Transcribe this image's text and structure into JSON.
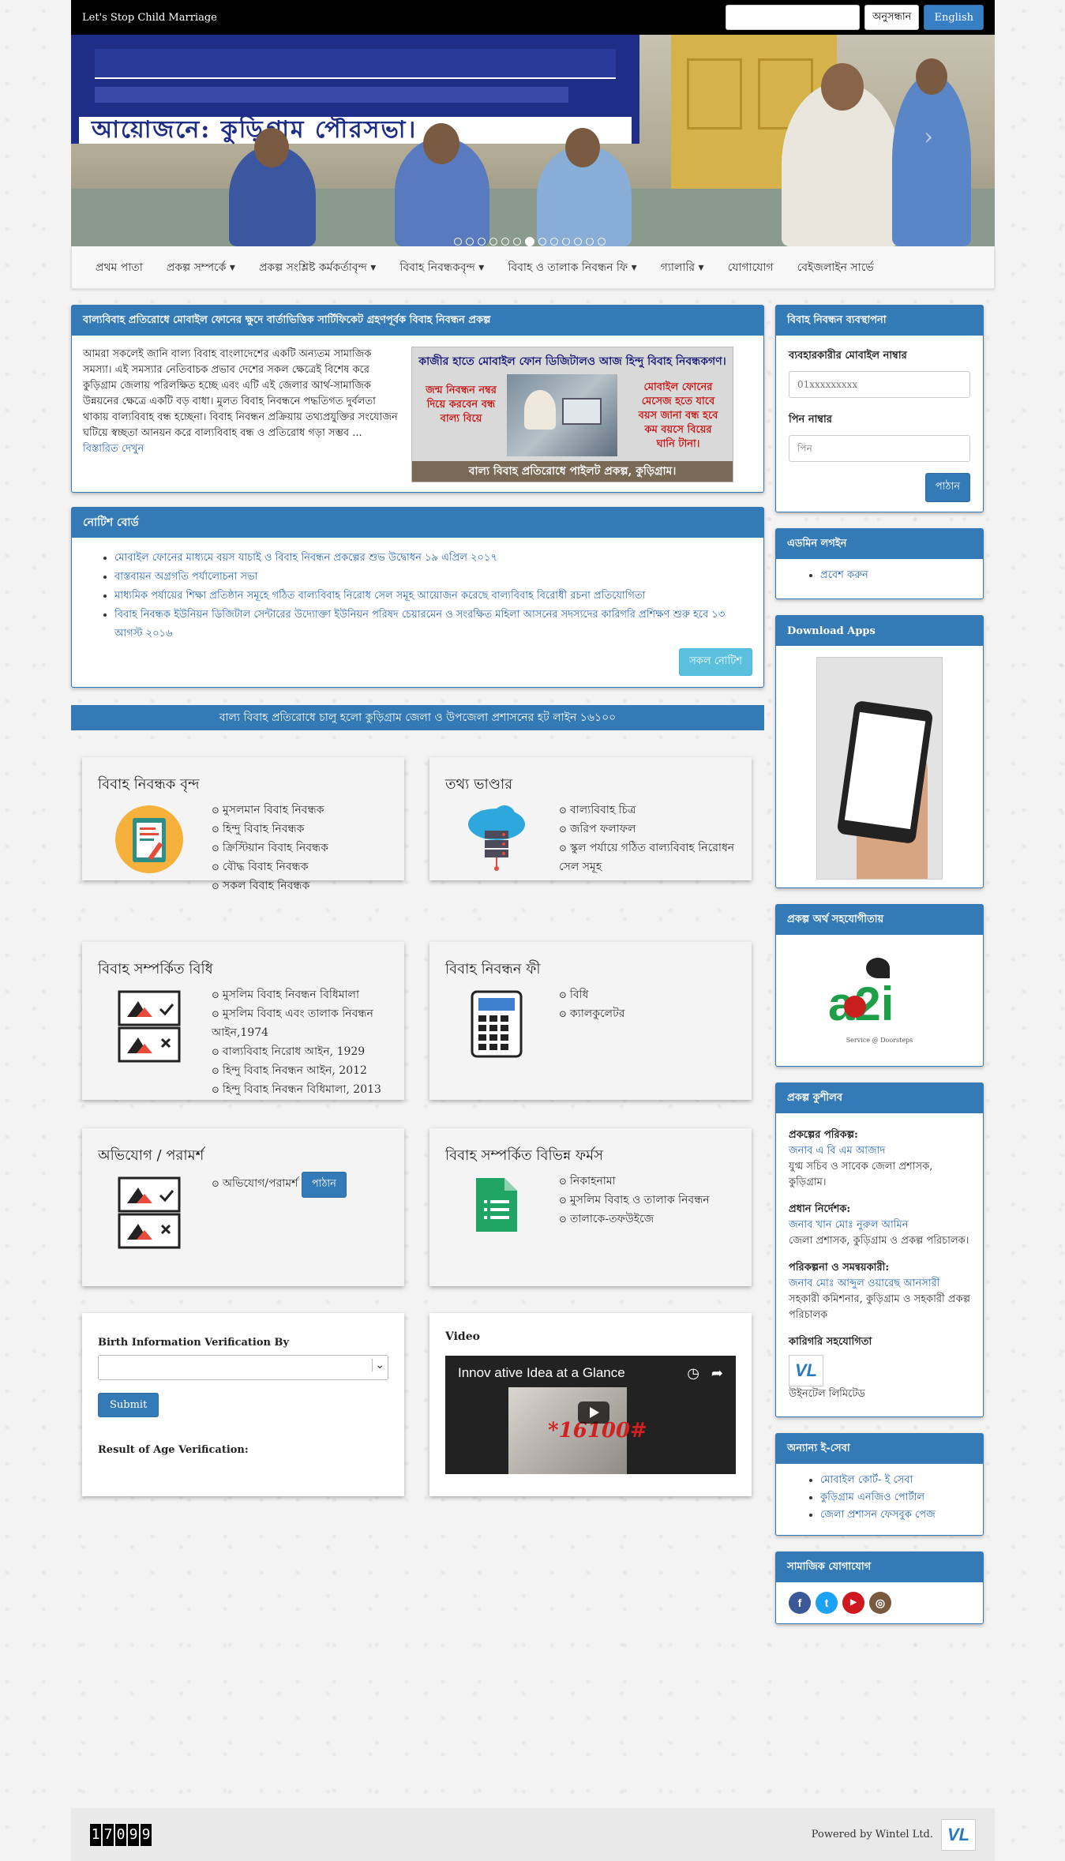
{
  "topbar": {
    "brand": "Let's Stop Child Marriage",
    "search_button": "অনুসন্ধান",
    "lang_button": "English"
  },
  "slider": {
    "banner_text": "আয়োজনে: কুড়িগ্রাম পৌরসভা।",
    "active_slide": 7,
    "total_slides": 13
  },
  "nav": {
    "items": [
      "প্রথম পাতা",
      "প্রকল্প সম্পর্কে ▾",
      "প্রকল্প সংশ্লিষ্ট কর্মকর্তাবৃন্দ ▾",
      "বিবাহ নিবন্ধকবৃন্দ ▾",
      "বিবাহ ও তালাক নিবন্ধন ফি ▾",
      "গ্যালারি ▾",
      "যোগাযোগ",
      "বেইজলাইন সার্ভে"
    ]
  },
  "intro": {
    "title": "বাল্যবিবাহ প্রতিরোধে মোবাইল ফোনের ক্ষুদে বার্তাভিত্তিক সার্টিফিকেট গ্রহণপূর্বক বিবাহ নিবন্ধন প্রকল্প",
    "text": "আমরা সকলেই জানি বাল্য বিবাহ বাংলাদেশের একটি অন্যতম সামাজিক সমস্যা। এই সমস্যার নেতিবাচক প্রভাব দেশের সকল ক্ষেত্রেই বিশেষ করে কুড়িগ্রাম জেলায় পরিলক্ষিত হচ্ছে এবং এটি এই জেলার আর্থ-সামাজিক উন্নয়নের ক্ষেত্রে একটি বড় বাধা। মুলত বিবাহ নিবন্ধনে পদ্ধতিগত দুর্বলতা থাকায় বাল্যবিবাহ বন্ধ হচ্ছেনা। বিবাহ নিবন্ধন প্রক্রিয়ায় তথ্যপ্রযুক্তির সংযোজন ঘটিয়ে স্বচ্ছতা আনয়ন করে বাল্যবিবাহ বন্ধ ও প্রতিরোধ গড়া সম্ভব ... ",
    "more": "বিস্তারিত দেখুন",
    "promo": {
      "title": "কাজীর হাতে মোবাইল ফোন ডিজিটালও আজ হিন্দু বিবাহ নিবন্ধকগণ।",
      "left": "জন্ম নিবন্ধন নম্বর দিয়ে করবেন বন্ধ বাল্য বিয়ে",
      "right": "মোবাইল ফোনের মেসেজ হতে যাবে বয়স জানা বন্ধ হবে কম বয়সে বিয়ের ঘানি টানা।",
      "bottom": "বাল্য বিবাহ প্রতিরোধে পাইলট প্রকল্প, কুড়িগ্রাম।"
    }
  },
  "notice": {
    "title": "নোটিশ বোর্ড",
    "items": [
      "মোবাইল ফোনের মাধ্যমে বয়স যাচাই ও বিবাহ নিবন্ধন প্রকল্পের শুভ উদ্বোধন ১৯ এপ্রিল ২০১৭",
      "বাস্তবায়ন অগ্রগতি পর্যালোচনা সভা",
      "মাধ্যমিক পর্যায়ের শিক্ষা প্রতিষ্ঠান সমূহে গঠিত বাল্যবিবাহ নিরোধ সেল সমূহ আয়োজন করেছে বাল্যবিবাহ বিরোধী রচনা প্রতিযোগিতা",
      "বিবাহ নিবন্ধক ইউনিয়ন ডিজিটাল সেন্টারের উদ্যোক্তা ইউনিয়ন পরিষদ চেয়ারমেন ও সংরক্ষিত মহিলা আসনের সদস্যদের কারিগরি প্রশিক্ষণ শুরু হবে ১৩ আগস্ট ২০১৬"
    ],
    "all_button": "সকল নোটিশ"
  },
  "hotline": "বাল্য বিবাহ প্রতিরোধে চালু হলো কুড়িগ্রাম জেলা ও উপজেলা প্রশাসনের হট লাইন ১৬১০০",
  "cards": {
    "registrars": {
      "title": "বিবাহ নিবন্ধক বৃন্দ",
      "items": [
        "মুসলমান বিবাহ নিবন্ধক",
        "হিন্দু বিবাহ নিবন্ধক",
        "ক্রিস্টিয়ান বিবাহ নিবন্ধক",
        "বৌদ্ধ বিবাহ নিবন্ধক",
        "সকল বিবাহ নিবন্ধক"
      ]
    },
    "info": {
      "title": "তথ্য ভাণ্ডার",
      "items": [
        "বাল্যবিবাহ চিত্র",
        "জরিপ ফলাফল",
        "স্কুল পর্যায়ে গঠিত বাল্যবিবাহ নিরোধন সেল সমূহ"
      ]
    },
    "rules": {
      "title": "বিবাহ সম্পর্কিত বিধি",
      "items": [
        "মুসলিম বিবাহ নিবন্ধন বিধিমালা",
        "মুসলিম বিবাহ এবং তালাক নিবন্ধন আইন,1974",
        "বাল্যবিবাহ নিরোধ আইন, 1929",
        "হিন্দু বিবাহ নিবন্ধন আইন, 2012",
        "হিন্দু বিবাহ নিবন্ধন বিধিমালা, 2013"
      ]
    },
    "fee": {
      "title": "বিবাহ নিবন্ধন ফী",
      "items": [
        "বিধি",
        "ক্যালকুলেটর"
      ]
    },
    "complaint": {
      "title": "অভিযোগ / পরামর্শ",
      "items": [
        "অভিযোগ/পরামর্শ"
      ],
      "button": "পাঠান"
    },
    "forms": {
      "title": "বিবাহ সম্পর্কিত বিভিন্ন ফর্মস",
      "items": [
        "নিকাহনামা",
        "মুসলিম বিবাহ ও তালাক নিবন্ধন",
        "তালাকে-তফউইজে"
      ]
    },
    "verify": {
      "label": "Birth Information Verification By",
      "submit": "Submit",
      "result": "Result of Age Verification:"
    },
    "video": {
      "title": "Video",
      "video_title": "Innov ative Idea at a Glance",
      "number": "*16100#"
    }
  },
  "sidebar": {
    "registration": {
      "title": "বিবাহ নিবন্ধন ব্যবস্থাপনা",
      "mobile_label": "ব্যবহারকারীর মোবাইল নাম্বার",
      "mobile_placeholder": "01xxxxxxxxx",
      "pin_label": "পিন নাম্বার",
      "pin_placeholder": "পিন",
      "send": "পাঠান"
    },
    "admin": {
      "title": "এডমিন লগইন",
      "link": "প্রবেশ করুন"
    },
    "apps": {
      "title": "Download Apps"
    },
    "funding": {
      "title": "প্রকল্প অর্থ সহযোগীতায়",
      "logo": "a2i",
      "tagline": "Service @ Doorsteps"
    },
    "staff": {
      "title": "প্রকল্প কুশীলব",
      "director_role": "প্রকল্পের পরিকল্প:",
      "director_name": "জনাব এ বি এম আজাদ",
      "director_desc": "যুগ্ম সচিব ও সাবেক জেলা প্রশাসক, কুড়িগ্রাম।",
      "chief_role": "প্রধান নির্দেশক:",
      "chief_name": "জনাব খান মোঃ নুরুল আমিন",
      "chief_desc": "জেলা প্রশাসক, কুড়িগ্রাম ও প্রকল্প পরিচালক।",
      "plan_role": "পরিকল্পনা ও সমন্বয়কারী:",
      "plan_name": "জনাব মোঃ আব্দুল ওয়ারেছ আনসারী",
      "plan_desc": "সহকারী কমিশনার, কুড়িগ্রাম ও সহকারী প্রকল্প পরিচালক",
      "tech_role": "কারিগরি সহযোগিতা",
      "tech_logo": "VL",
      "tech_name": "উইনটেল লিমিটেড"
    },
    "eservice": {
      "title": "অন্যান্য ই-সেবা",
      "items": [
        "মোবাইল কোর্ট- ই সেবা",
        "কুড়িগ্রাম এনজিও পোর্টাল",
        "জেলা প্রশাসন ফেসবুক পেজ"
      ]
    },
    "social": {
      "title": "সামাজিক যোগাযোগ",
      "icons": [
        "facebook-icon",
        "twitter-icon",
        "youtube-icon",
        "instagram-icon"
      ]
    }
  },
  "footer": {
    "counter": [
      "1",
      "7",
      "0",
      "9",
      "9"
    ],
    "powered": "Powered by Wintel Ltd.",
    "logo": "VL"
  }
}
